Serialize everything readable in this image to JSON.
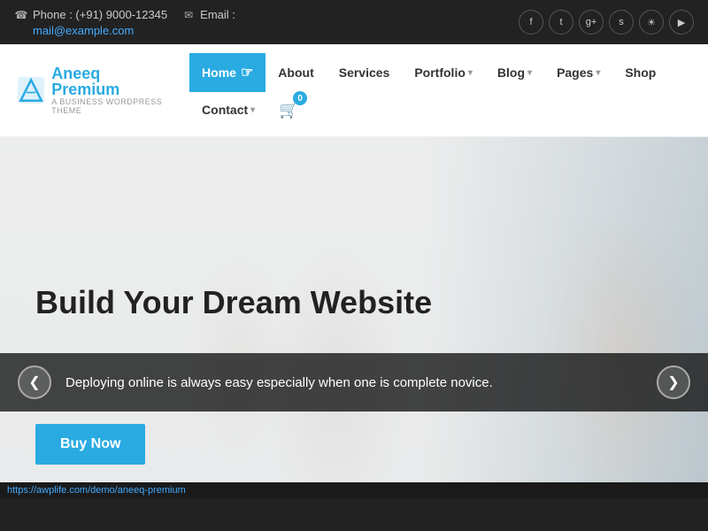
{
  "topbar": {
    "phone_icon": "☎",
    "phone_label": "Phone : (+91) 9000-12345",
    "email_icon": "✉",
    "email_label": "Email :",
    "email_address": "mail@example.com",
    "social_icons": [
      {
        "name": "facebook-icon",
        "symbol": "f"
      },
      {
        "name": "twitter-icon",
        "symbol": "t"
      },
      {
        "name": "googleplus-icon",
        "symbol": "g+"
      },
      {
        "name": "skype-icon",
        "symbol": "s"
      },
      {
        "name": "instagram-icon",
        "symbol": "in"
      },
      {
        "name": "youtube-icon",
        "symbol": "▶"
      }
    ]
  },
  "logo": {
    "brand": "Aneeq",
    "brand_accent": "Premium",
    "tagline": "A Business WordPress Theme"
  },
  "nav": {
    "items": [
      {
        "label": "Home",
        "active": true,
        "has_dropdown": false
      },
      {
        "label": "About",
        "active": false,
        "has_dropdown": false
      },
      {
        "label": "Services",
        "active": false,
        "has_dropdown": false
      },
      {
        "label": "Portfolio",
        "active": false,
        "has_dropdown": true
      },
      {
        "label": "Blog",
        "active": false,
        "has_dropdown": true
      },
      {
        "label": "Pages",
        "active": false,
        "has_dropdown": true
      },
      {
        "label": "Shop",
        "active": false,
        "has_dropdown": false
      },
      {
        "label": "Contact",
        "active": false,
        "has_dropdown": true
      }
    ],
    "cart_count": "0"
  },
  "hero": {
    "title": "Build Your Dream Website",
    "subtitle": "Deploying online is always easy especially when one is complete novice.",
    "btn_label": "Buy Now",
    "prev_arrow": "❮",
    "next_arrow": "❯"
  },
  "statusbar": {
    "url": "https://awplife.com/demo/aneeq-premium"
  }
}
